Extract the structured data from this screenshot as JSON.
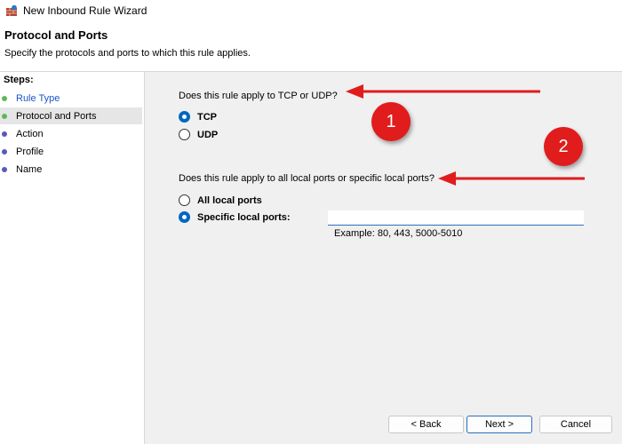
{
  "window": {
    "title": "New Inbound Rule Wizard",
    "icon": "firewall-icon"
  },
  "header": {
    "title": "Protocol and Ports",
    "subtitle": "Specify the protocols and ports to which this rule applies."
  },
  "steps": {
    "heading": "Steps:",
    "items": [
      {
        "label": "Rule Type",
        "status": "done",
        "dot_color": "#5cb85c"
      },
      {
        "label": "Protocol and Ports",
        "status": "current",
        "dot_color": "#5cb85c"
      },
      {
        "label": "Action",
        "status": "pending",
        "dot_color": "#5a5ab8"
      },
      {
        "label": "Profile",
        "status": "pending",
        "dot_color": "#5a5ab8"
      },
      {
        "label": "Name",
        "status": "pending",
        "dot_color": "#5a5ab8"
      }
    ]
  },
  "protocol": {
    "question": "Does this rule apply to TCP or UDP?",
    "options": [
      {
        "label": "TCP",
        "checked": true
      },
      {
        "label": "UDP",
        "checked": false
      }
    ]
  },
  "ports": {
    "question": "Does this rule apply to all local ports or specific local ports?",
    "options": [
      {
        "label": "All local ports",
        "checked": false
      },
      {
        "label": "Specific local ports:",
        "checked": true
      }
    ],
    "input_value": "",
    "example": "Example: 80, 443, 5000-5010"
  },
  "buttons": {
    "back": "< Back",
    "next": "Next >",
    "cancel": "Cancel"
  },
  "annotations": {
    "badge_1": "1",
    "badge_2": "2",
    "color": "#e11c1c"
  }
}
